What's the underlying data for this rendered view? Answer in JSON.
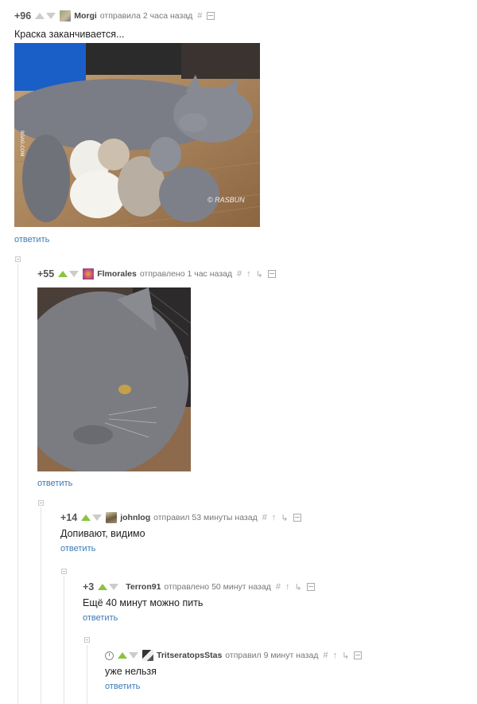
{
  "comments": [
    {
      "rating": "+96",
      "author": "Morgi",
      "meta": "отправила 2 часа назад",
      "text": "Краска заканчивается...",
      "reply": "ответить"
    },
    {
      "rating": "+55",
      "author": "Flmorales",
      "meta": "отправлено 1 час назад",
      "reply": "ответить"
    },
    {
      "rating": "+14",
      "author": "johnlog",
      "meta": "отправил 53 минуты назад",
      "text": "Допивают, видимо",
      "reply": "ответить"
    },
    {
      "rating": "+3",
      "author": "Terron91",
      "meta": "отправлено 50 минут назад",
      "text": "Ещё 40 минут можно пить",
      "reply": "ответить"
    },
    {
      "author": "TritseratopsStas",
      "meta": "отправил 9 минут назад",
      "text": "уже нельзя",
      "reply": "ответить"
    }
  ],
  "tools": {
    "hash": "#",
    "up": "↑",
    "branch": "↳"
  },
  "image1": {
    "watermark": "9GAG.COM",
    "caption": "© RASBUN"
  },
  "colors": {
    "link": "#3a7ab8",
    "upvote": "#8ac43f",
    "muted": "#cccccc"
  }
}
